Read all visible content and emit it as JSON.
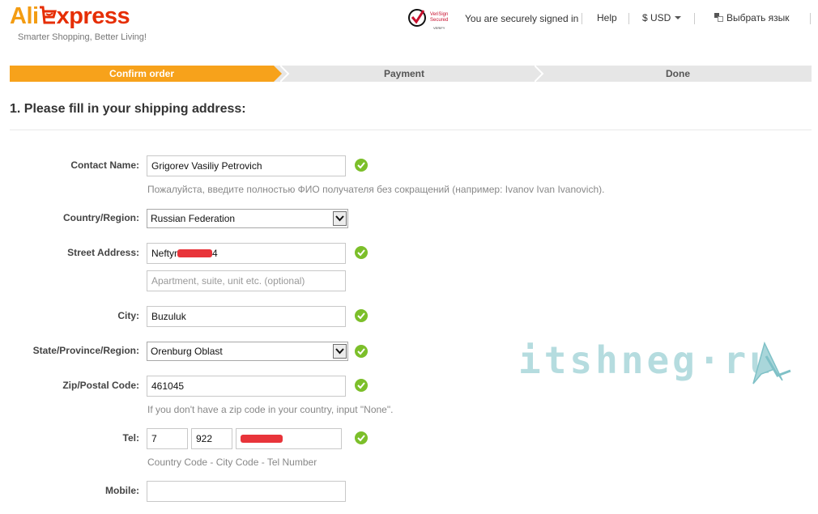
{
  "header": {
    "logo_ali": "Ali",
    "logo_express": "xpress",
    "tagline": "Smarter Shopping, Better Living!",
    "badge_line1": "VeriSign",
    "badge_line2": "Secured",
    "badge_line3": "VERIFY",
    "secure_text": "You are securely signed in",
    "help": "Help",
    "currency": "$ USD",
    "language": "Выбрать язык"
  },
  "steps": [
    {
      "label": "Confirm order",
      "active": true
    },
    {
      "label": "Payment",
      "active": false
    },
    {
      "label": "Done",
      "active": false
    }
  ],
  "section_title": "1. Please fill in your shipping address:",
  "form": {
    "contact_name": {
      "label": "Contact Name:",
      "value": "Grigorev Vasiliy Petrovich",
      "hint": "Пожалуйста, введите полностью ФИО получателя без сокращений (например: Ivanov Ivan Ivanovich)."
    },
    "country": {
      "label": "Country/Region:",
      "value": "Russian Federation"
    },
    "street": {
      "label": "Street Address:",
      "value_prefix": "Neftyr",
      "value_suffix": "4",
      "placeholder2": "Apartment, suite, unit etc. (optional)"
    },
    "city": {
      "label": "City:",
      "value": "Buzuluk"
    },
    "state": {
      "label": "State/Province/Region:",
      "value": "Orenburg Oblast"
    },
    "zip": {
      "label": "Zip/Postal Code:",
      "value": "461045",
      "hint": "If you don't have a zip code in your country, input \"None\"."
    },
    "tel": {
      "label": "Tel:",
      "country_code": "7",
      "city_code": "922",
      "hint": "Country Code - City Code - Tel Number"
    },
    "mobile": {
      "label": "Mobile:",
      "value": ""
    }
  },
  "watermark": "itshneg·ru",
  "colors": {
    "accent": "#f7a21b",
    "brand_red": "#e62e04",
    "check": "#7cbf2a"
  }
}
